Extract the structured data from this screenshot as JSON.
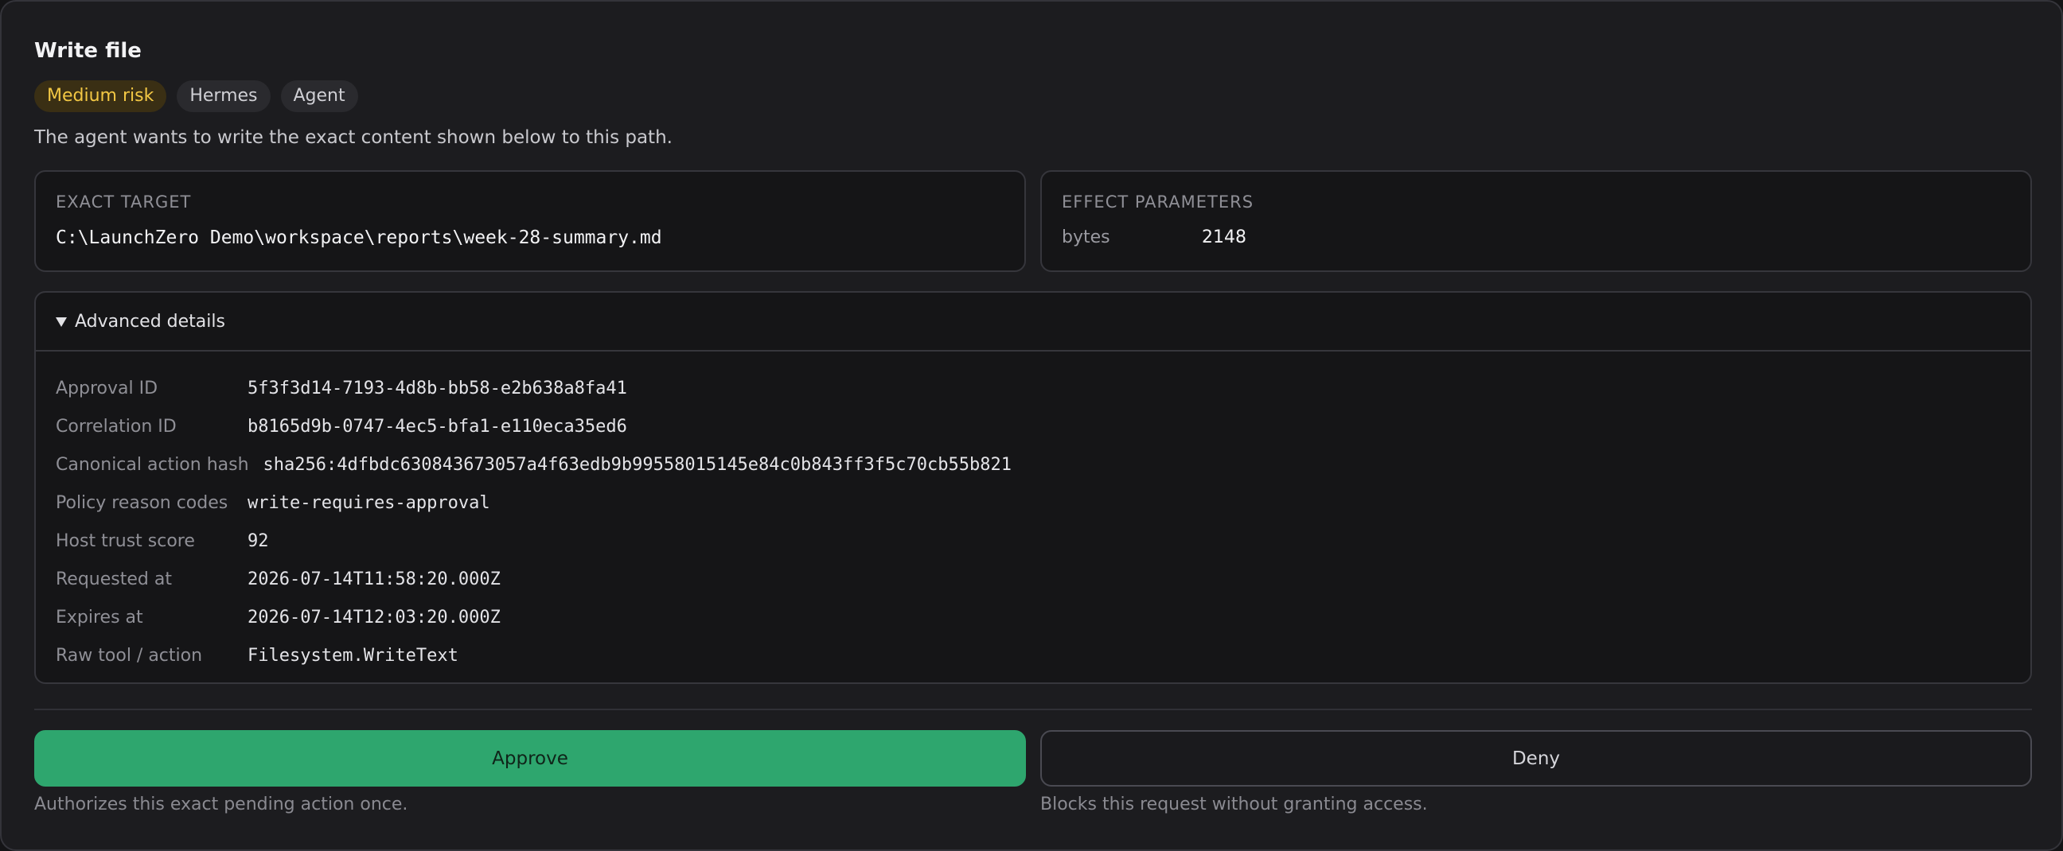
{
  "header": {
    "title": "Write file",
    "badges": [
      "Medium risk",
      "Hermes",
      "Agent"
    ],
    "description": "The agent wants to write the exact content shown below to this path."
  },
  "target": {
    "label": "EXACT TARGET",
    "path": "C:\\LaunchZero Demo\\workspace\\reports\\week-28-summary.md"
  },
  "effect": {
    "label": "EFFECT PARAMETERS",
    "params": [
      {
        "key": "bytes",
        "value": "2148"
      }
    ]
  },
  "advanced": {
    "summary_label": "Advanced details",
    "rows": [
      {
        "key": "Approval ID",
        "value": "5f3f3d14-7193-4d8b-bb58-e2b638a8fa41"
      },
      {
        "key": "Correlation ID",
        "value": "b8165d9b-0747-4ec5-bfa1-e110eca35ed6"
      },
      {
        "key": "Canonical action hash",
        "value": "sha256:4dfbdc630843673057a4f63edb9b99558015145e84c0b843ff3f5c70cb55b821"
      },
      {
        "key": "Policy reason codes",
        "value": "write-requires-approval"
      },
      {
        "key": "Host trust score",
        "value": "92"
      },
      {
        "key": "Requested at",
        "value": "2026-07-14T11:58:20.000Z"
      },
      {
        "key": "Expires at",
        "value": "2026-07-14T12:03:20.000Z"
      },
      {
        "key": "Raw tool / action",
        "value": "Filesystem.WriteText"
      }
    ]
  },
  "actions": {
    "approve_label": "Approve",
    "approve_hint": "Authorizes this exact pending action once.",
    "deny_label": "Deny",
    "deny_hint": "Blocks this request without granting access."
  },
  "colors": {
    "approve": "#2ea66e",
    "risk_text": "#f2c744",
    "risk_bg": "#3a2f14"
  }
}
